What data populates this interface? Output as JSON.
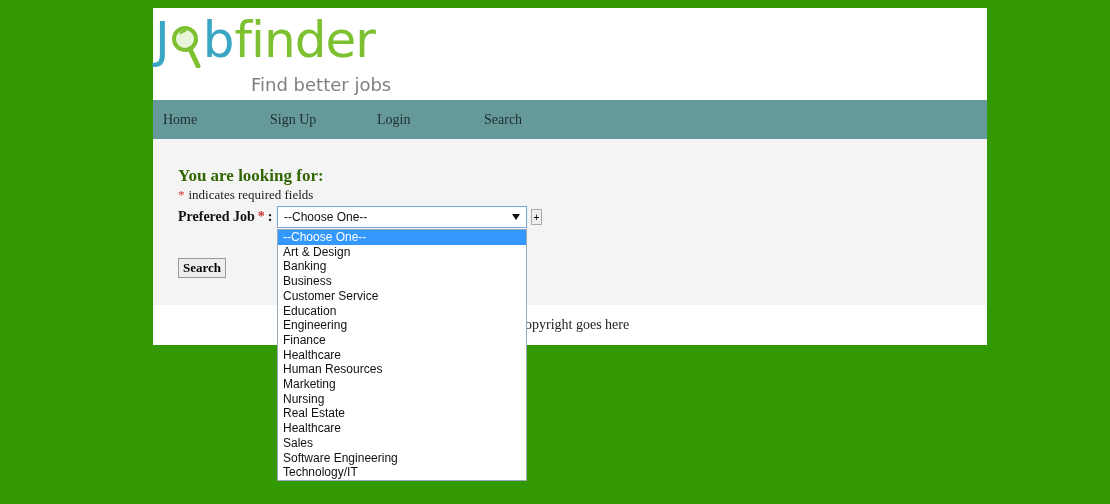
{
  "logo": {
    "lead": "J",
    "middle": "b",
    "tail": "finder",
    "tagline": "Find better jobs"
  },
  "nav": [
    {
      "label": "Home"
    },
    {
      "label": "Sign Up"
    },
    {
      "label": "Login"
    },
    {
      "label": "Search"
    }
  ],
  "form": {
    "heading": "You are looking for:",
    "required_mark": "*",
    "required_note": "indicates required fields",
    "field_label": "Prefered Job",
    "field_colon": ":",
    "select_value": "--Choose One--",
    "add_button": "+",
    "submit_button": "Search",
    "options": [
      {
        "label": "--Choose One--",
        "selected": true
      },
      {
        "label": "Art & Design",
        "selected": false
      },
      {
        "label": "Banking",
        "selected": false
      },
      {
        "label": "Business",
        "selected": false
      },
      {
        "label": "Customer Service",
        "selected": false
      },
      {
        "label": "Education",
        "selected": false
      },
      {
        "label": "Engineering",
        "selected": false
      },
      {
        "label": "Finance",
        "selected": false
      },
      {
        "label": "Healthcare",
        "selected": false
      },
      {
        "label": "Human Resources",
        "selected": false
      },
      {
        "label": "Marketing",
        "selected": false
      },
      {
        "label": "Nursing",
        "selected": false
      },
      {
        "label": "Real Estate",
        "selected": false
      },
      {
        "label": "Healthcare",
        "selected": false
      },
      {
        "label": "Sales",
        "selected": false
      },
      {
        "label": "Software Engineering",
        "selected": false
      },
      {
        "label": "Technology/IT",
        "selected": false
      }
    ]
  },
  "footer": {
    "text": "opyright goes here"
  }
}
